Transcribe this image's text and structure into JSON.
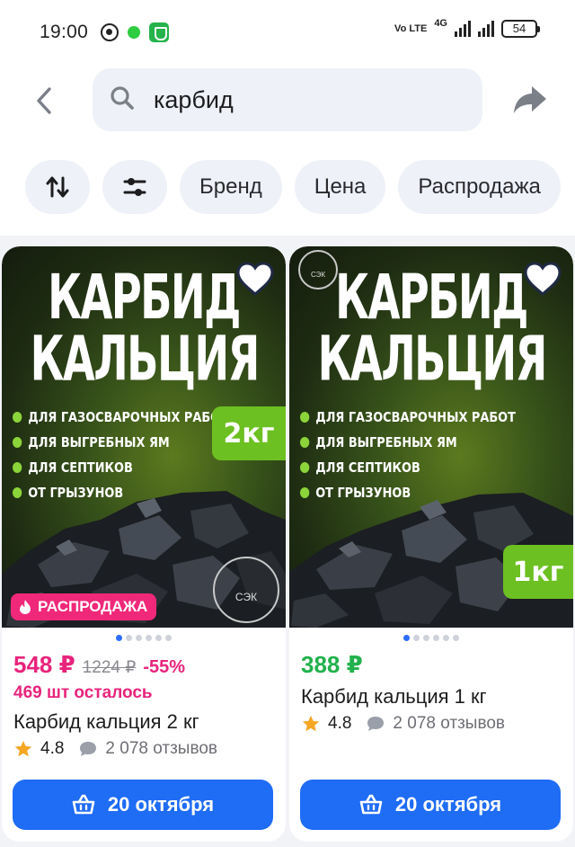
{
  "status_bar": {
    "time": "19:00",
    "volte": "Vo LTE",
    "network": "4G",
    "battery": "54",
    "icons": [
      "whatsapp-icon",
      "chat-green-icon",
      "shield-icon",
      "signal-icon",
      "battery-icon"
    ]
  },
  "search": {
    "value": "карбид",
    "icons": [
      "back-icon",
      "search-icon",
      "share-icon"
    ]
  },
  "filters": {
    "sort_icon": "sort-icon",
    "settings_icon": "filters-icon",
    "chips": [
      "Бренд",
      "Цена",
      "Распродажа"
    ]
  },
  "colors": {
    "accent_blue": "#1f6cf5",
    "sale_pink": "#e8247c",
    "price_green": "#22b14c",
    "weight_badge_green": "#6cc021"
  },
  "products": [
    {
      "image_title": "КАРБИД КАЛЬЦИЯ",
      "image_bullets": [
        "ДЛЯ ГАЗОСВАРОЧНЫХ РАБОТ",
        "ДЛЯ ВЫГРЕБНЫХ ЯМ",
        "ДЛЯ СЕПТИКОВ",
        "ОТ ГРЫЗУНОВ"
      ],
      "weight_badge": "2кг",
      "logo_text": "СЭК",
      "sale_badge": "РАСПРОДАЖА",
      "image_dots": 6,
      "active_dot": 0,
      "price": "548 ₽",
      "old_price": "1224 ₽",
      "discount": "-55%",
      "stock_left": "469 шт осталось",
      "name": "Карбид кальция 2 кг",
      "rating": "4.8",
      "reviews": "2 078 отзывов",
      "delivery_button": "20 октября"
    },
    {
      "image_title": "КАРБИД КАЛЬЦИЯ",
      "image_bullets": [
        "ДЛЯ ГАЗОСВАРОЧНЫХ РАБОТ",
        "ДЛЯ ВЫГРЕБНЫХ ЯМ",
        "ДЛЯ СЕПТИКОВ",
        "ОТ ГРЫЗУНОВ"
      ],
      "weight_badge": "1кг",
      "logo_text": "СЭК",
      "image_dots": 6,
      "active_dot": 0,
      "price": "388 ₽",
      "name": "Карбид кальция 1 кг",
      "rating": "4.8",
      "reviews": "2 078 отзывов",
      "delivery_button": "20 октября"
    }
  ]
}
